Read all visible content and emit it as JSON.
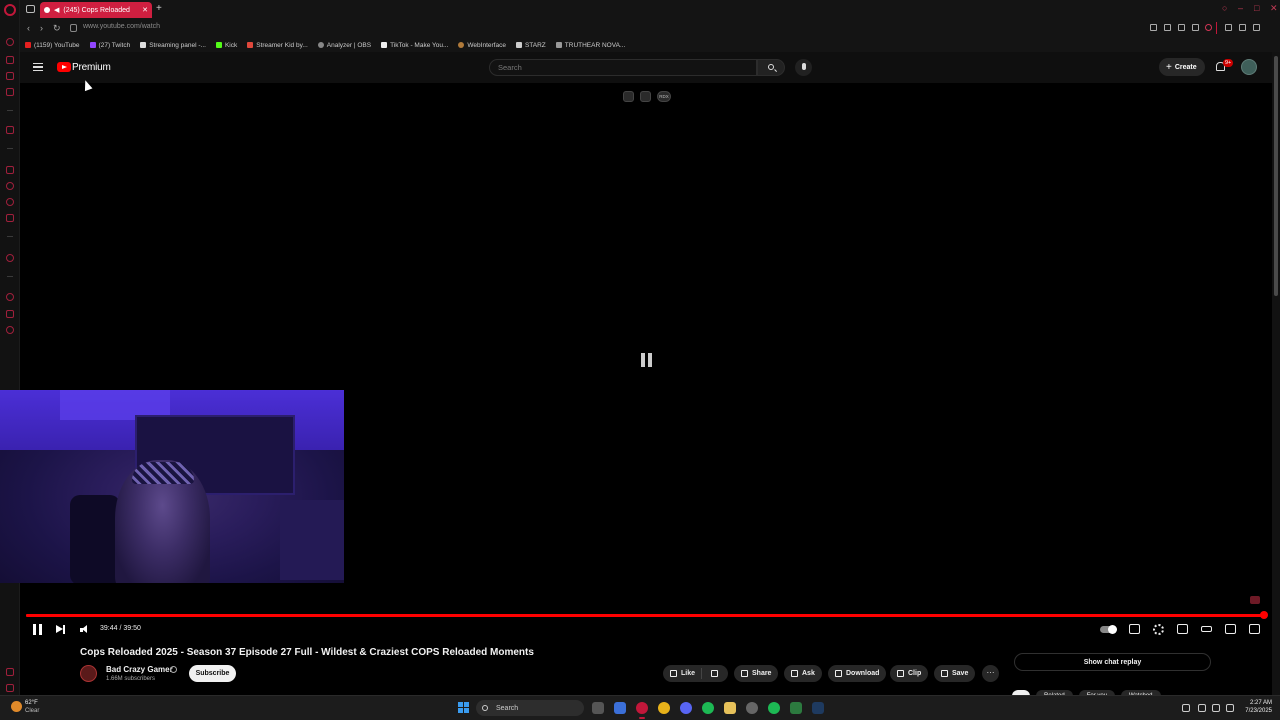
{
  "browser": {
    "tab_title": "(245) Cops Reloaded",
    "url": "www.youtube.com/watch",
    "accent_color": "#cf1f40",
    "bookmarks": [
      "(1159) YouTube",
      "(27) Twitch",
      "Streaming panel -...",
      "Kick",
      "Streamer Kid by...",
      "Analyzer | OBS",
      "TikTok - Make You...",
      "WebInterface",
      "STARZ",
      "TRUTHEAR NOVA..."
    ]
  },
  "youtube": {
    "logo_label": "Premium",
    "search_placeholder": "Search",
    "create_label": "Create",
    "notif_badge": "9+",
    "ext_badge": "RDX"
  },
  "player": {
    "time": "39:44 / 39:50",
    "progress_fraction": 0.998
  },
  "video": {
    "title": "Cops Reloaded 2025 - Season 37 Episode 27 Full - Wildest & Craziest COPS Reloaded Moments",
    "channel": "Bad Crazy Gamer",
    "subscribers": "1.66M subscribers",
    "subscribe_label": "Subscribe",
    "like_label": "Like",
    "share_label": "Share",
    "ask_label": "Ask",
    "download_label": "Download",
    "clip_label": "Clip",
    "save_label": "Save",
    "more_label": "···",
    "chat_replay_label": "Show chat replay",
    "chips": [
      "Related",
      "For you",
      "Watched"
    ]
  },
  "taskbar": {
    "weather_temp": "62°F",
    "weather_desc": "Clear",
    "search_label": "Search",
    "time": "2:27 AM",
    "date": "7/23/2025"
  }
}
